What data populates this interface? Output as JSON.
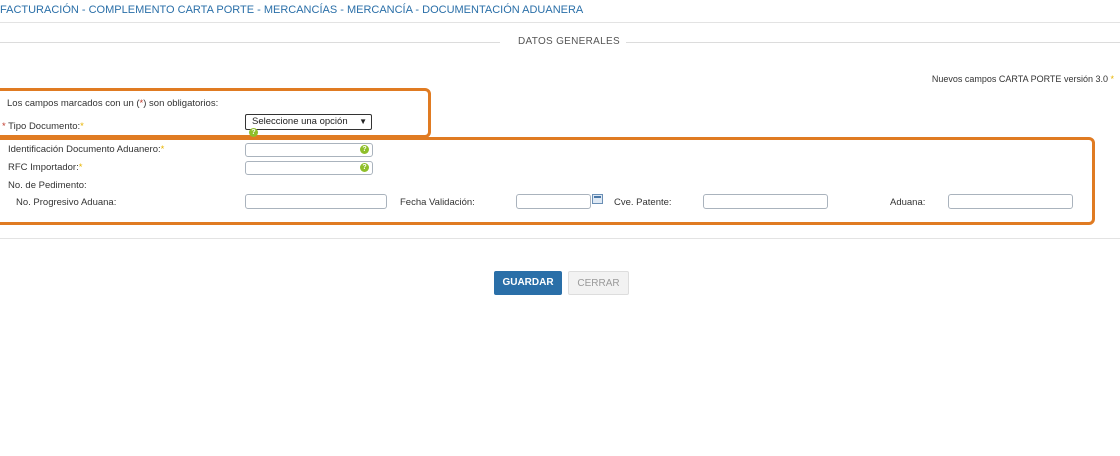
{
  "breadcrumb": "FACTURACIÓN - COMPLEMENTO CARTA PORTE - MERCANCÍAS - MERCANCÍA - DOCUMENTACIÓN ADUANERA",
  "section_title": "DATOS GENERALES",
  "version_note": "Nuevos campos CARTA PORTE versión 3.0",
  "required_note": {
    "before": "Los campos marcados con un (",
    "marker": "*",
    "after": ") son obligatorios:"
  },
  "fields": {
    "tipo_documento": {
      "label": "Tipo Documento:",
      "value": "Seleccione una opción"
    },
    "id_documento": {
      "label": "Identificación Documento Aduanero:",
      "value": ""
    },
    "rfc_importador": {
      "label": "RFC Importador:",
      "value": ""
    },
    "no_pedimento": {
      "label": "No. de Pedimento:"
    },
    "no_progresivo": {
      "label": "No. Progresivo Aduana:",
      "value": ""
    },
    "fecha_validacion": {
      "label": "Fecha Validación:",
      "value": ""
    },
    "cve_patente": {
      "label": "Cve. Patente:",
      "value": ""
    },
    "aduana": {
      "label": "Aduana:",
      "value": ""
    }
  },
  "asterisk": "*",
  "help_glyph": "?",
  "buttons": {
    "save": "GUARDAR",
    "close": "CERRAR"
  },
  "colors": {
    "accent": "#2a6fa8",
    "highlight": "#e07b22",
    "required": "#e8b400",
    "help": "#8fbf2a"
  },
  "icons": {
    "help": "help-icon",
    "calendar": "calendar-icon",
    "dropdown": "chevron-down-icon"
  }
}
